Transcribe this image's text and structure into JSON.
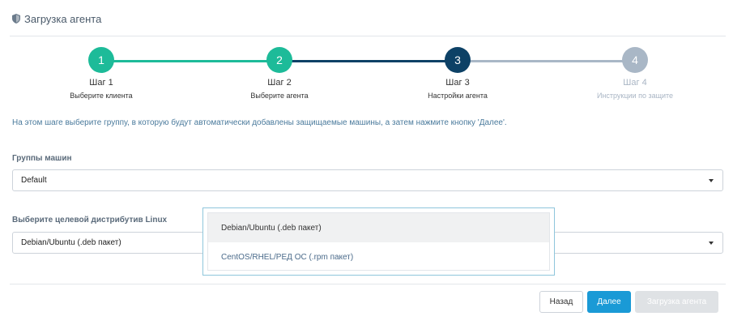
{
  "header": {
    "title": "Загрузка агента",
    "icon": "shield-icon"
  },
  "wizard": {
    "steps": [
      {
        "number": "1",
        "title": "Шаг 1",
        "subtitle": "Выберите клиента",
        "state": "done",
        "color": "#1dbb99"
      },
      {
        "number": "2",
        "title": "Шаг 2",
        "subtitle": "Выберите агента",
        "state": "done",
        "color": "#1dbb99"
      },
      {
        "number": "3",
        "title": "Шаг 3",
        "subtitle": "Настройки агента",
        "state": "current",
        "color": "#0d4166"
      },
      {
        "number": "4",
        "title": "Шаг 4",
        "subtitle": "Инструкции по защите",
        "state": "future",
        "color": "#a9b7c6"
      }
    ]
  },
  "instruction": "На этом шаге выберите группу, в которую будут автоматически добавлены защищаемые машины, а затем нажмите кнопку 'Далее'.",
  "groups": {
    "label": "Группы машин",
    "value": "Default"
  },
  "distro": {
    "label": "Выберите целевой дистрибутив Linux",
    "value": "Debian/Ubuntu (.deb пакет)",
    "options": [
      "Debian/Ubuntu (.deb пакет)",
      "CentOS/RHEL/РЕД ОС (.rpm пакет)"
    ]
  },
  "buttons": {
    "back": "Назад",
    "next": "Далее",
    "download": "Загрузка агента"
  }
}
